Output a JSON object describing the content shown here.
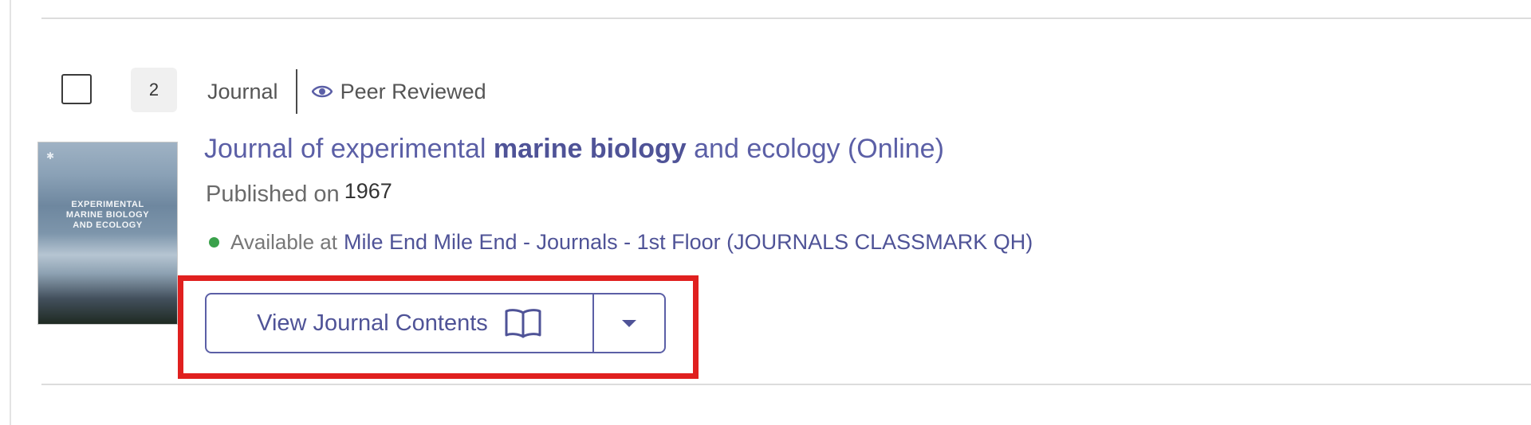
{
  "result": {
    "number": "2",
    "type": "Journal",
    "peer_reviewed": "Peer Reviewed",
    "title": {
      "before": "Journal of experimental ",
      "highlight": "marine biology",
      "after": " and ecology (Online)"
    },
    "published_label": "Published on",
    "published_year": "1967",
    "availability": {
      "label": "Available at",
      "location": "Mile End Mile End - Journals - 1st Floor (JOURNALS CLASSMARK QH)",
      "status_color": "#3aa14b"
    },
    "cover": {
      "lines": [
        "EXPERIMENTAL",
        "MARINE BIOLOGY",
        "AND ECOLOGY"
      ]
    },
    "actions": {
      "view_label": "View Journal Contents",
      "view_icon": "book-icon",
      "dropdown_icon": "chevron-down-icon"
    }
  },
  "colors": {
    "link": "#5b5fa6",
    "highlight_box": "#e0201f"
  }
}
